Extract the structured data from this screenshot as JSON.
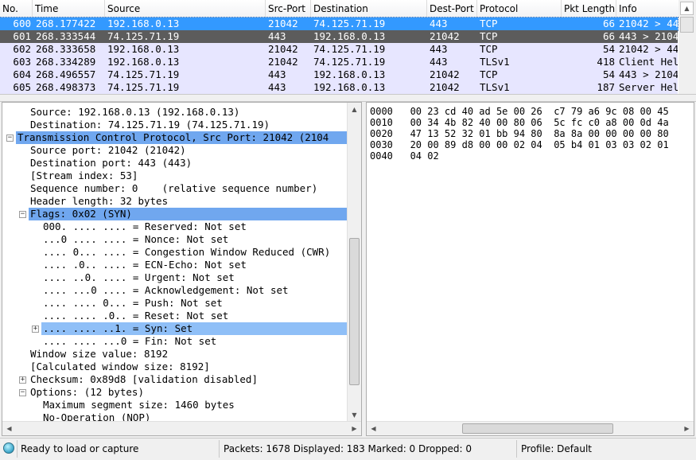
{
  "packet_list": {
    "columns": [
      "No.",
      "Time",
      "Source",
      "Src-Port",
      "Destination",
      "Dest-Port",
      "Protocol",
      "Pkt Length",
      "Info"
    ],
    "rows": [
      {
        "no": "600",
        "time": "268.177422",
        "source": "192.168.0.13",
        "src_port": "21042",
        "destination": "74.125.71.19",
        "dest_port": "443",
        "protocol": "TCP",
        "length": "66",
        "info": "21042 > 44",
        "state": "selected"
      },
      {
        "no": "601",
        "time": "268.333544",
        "source": "74.125.71.19",
        "src_port": "443",
        "destination": "192.168.0.13",
        "dest_port": "21042",
        "protocol": "TCP",
        "length": "66",
        "info": "443 > 2104",
        "state": "dark"
      },
      {
        "no": "602",
        "time": "268.333658",
        "source": "192.168.0.13",
        "src_port": "21042",
        "destination": "74.125.71.19",
        "dest_port": "443",
        "protocol": "TCP",
        "length": "54",
        "info": "21042 > 44",
        "state": "tcp"
      },
      {
        "no": "603",
        "time": "268.334289",
        "source": "192.168.0.13",
        "src_port": "21042",
        "destination": "74.125.71.19",
        "dest_port": "443",
        "protocol": "TLSv1",
        "length": "418",
        "info": "Client Hel",
        "state": "tls"
      },
      {
        "no": "604",
        "time": "268.496557",
        "source": "74.125.71.19",
        "src_port": "443",
        "destination": "192.168.0.13",
        "dest_port": "21042",
        "protocol": "TCP",
        "length": "54",
        "info": "443 > 2104",
        "state": "tcp"
      },
      {
        "no": "605",
        "time": "268.498373",
        "source": "74.125.71.19",
        "src_port": "443",
        "destination": "192.168.0.13",
        "dest_port": "21042",
        "protocol": "TLSv1",
        "length": "187",
        "info": "Server Hel",
        "state": "tls"
      }
    ]
  },
  "details": [
    "Source: 192.168.0.13 (192.168.0.13)",
    "Destination: 74.125.71.19 (74.125.71.19)",
    "Transmission Control Protocol, Src Port: 21042 (2104",
    "Source port: 21042 (21042)",
    "Destination port: 443 (443)",
    "[Stream index: 53]",
    "Sequence number: 0    (relative sequence number)",
    "Header length: 32 bytes",
    "Flags: 0x02 (SYN)",
    "000. .... .... = Reserved: Not set",
    "...0 .... .... = Nonce: Not set",
    ".... 0... .... = Congestion Window Reduced (CWR)",
    ".... .0.. .... = ECN-Echo: Not set",
    ".... ..0. .... = Urgent: Not set",
    ".... ...0 .... = Acknowledgement: Not set",
    ".... .... 0... = Push: Not set",
    ".... .... .0.. = Reset: Not set",
    ".... .... ..1. = Syn: Set",
    ".... .... ...0 = Fin: Not set",
    "Window size value: 8192",
    "[Calculated window size: 8192]",
    "Checksum: 0x89d8 [validation disabled]",
    "Options: (12 bytes)",
    "Maximum segment size: 1460 bytes",
    "No-Operation (NOP)"
  ],
  "bytes": [
    "0000   00 23 cd 40 ad 5e 00 26  c7 79 a6 9c 08 00 45",
    "0010   00 34 4b 82 40 00 80 06  5c fc c0 a8 00 0d 4a",
    "0020   47 13 52 32 01 bb 94 80  8a 8a 00 00 00 00 80",
    "0030   20 00 89 d8 00 00 02 04  05 b4 01 03 03 02 01",
    "0040   04 02"
  ],
  "status": {
    "ready": "Ready to load or capture",
    "packets": "Packets: 1678 Displayed: 183 Marked: 0 Dropped: 0",
    "profile": "Profile: Default"
  },
  "colors": {
    "selected": "#3399ff",
    "dark": "#5c5c5c",
    "tcp": "#e7e6ff",
    "tls": "#e7e6ff"
  }
}
